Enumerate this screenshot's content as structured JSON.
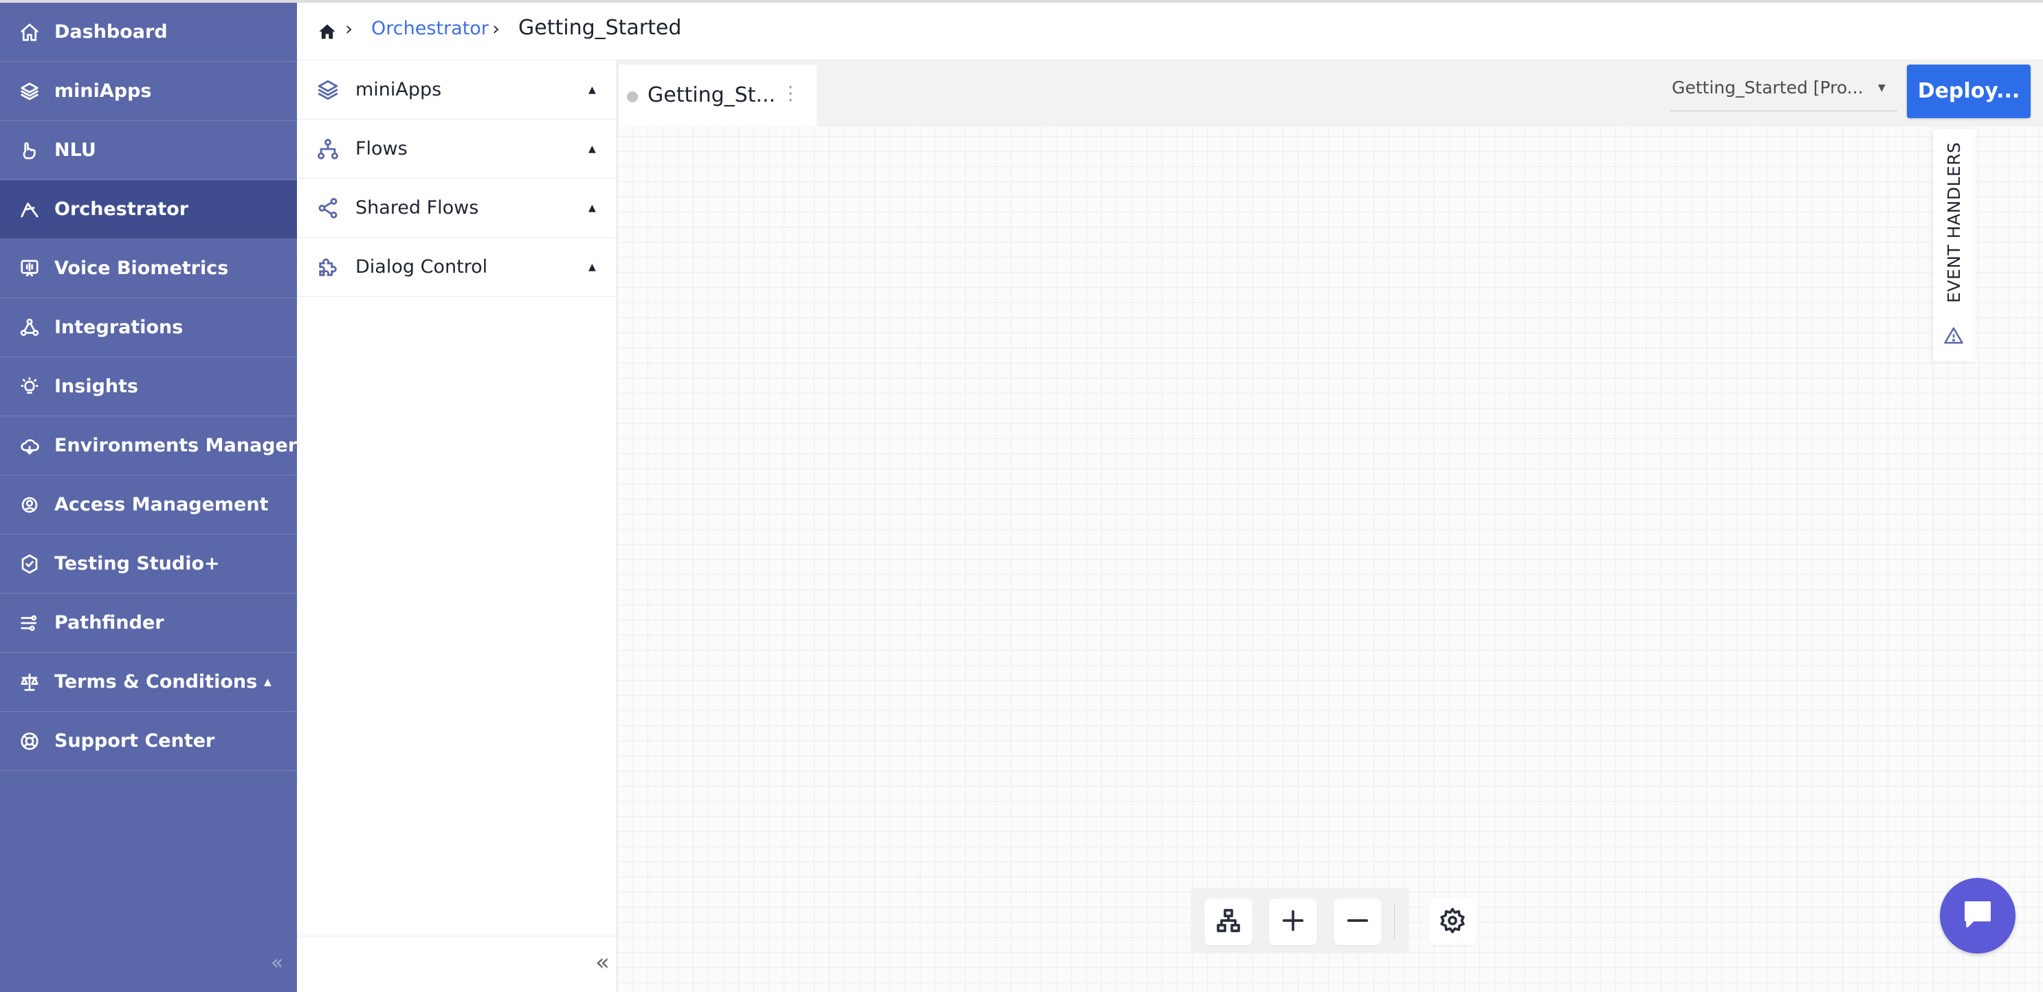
{
  "colors": {
    "sidebar_bg": "#5a67a8",
    "sidebar_active": "#3f4c8e",
    "link": "#3f6fe3",
    "deploy_button": "#2d6ee8",
    "chat_button": "#5c5ad6"
  },
  "sidebar": {
    "items": [
      {
        "label": "Dashboard",
        "icon": "home-icon"
      },
      {
        "label": "miniApps",
        "icon": "layers-icon"
      },
      {
        "label": "NLU",
        "icon": "nlu-icon"
      },
      {
        "label": "Orchestrator",
        "icon": "orchestrator-icon",
        "active": true
      },
      {
        "label": "Voice Biometrics",
        "icon": "voice-biometrics-icon"
      },
      {
        "label": "Integrations",
        "icon": "integrations-icon"
      },
      {
        "label": "Insights",
        "icon": "lightbulb-icon"
      },
      {
        "label": "Environments Manager",
        "icon": "cloud-icon"
      },
      {
        "label": "Access Management",
        "icon": "access-gear-icon"
      },
      {
        "label": "Testing Studio+",
        "icon": "testing-icon"
      },
      {
        "label": "Pathfinder",
        "icon": "pathfinder-icon"
      },
      {
        "label": "Terms & Conditions",
        "icon": "scale-icon",
        "expandable": true
      },
      {
        "label": "Support Center",
        "icon": "lifebuoy-icon"
      }
    ],
    "collapse_glyph": "«"
  },
  "breadcrumb": {
    "home_icon": "home-icon",
    "separator": "›",
    "link": "Orchestrator",
    "current": "Getting_Started"
  },
  "panel": {
    "items": [
      {
        "label": "miniApps",
        "icon": "layers-icon"
      },
      {
        "label": "Flows",
        "icon": "flows-icon"
      },
      {
        "label": "Shared Flows",
        "icon": "share-icon"
      },
      {
        "label": "Dialog Control",
        "icon": "puzzle-icon"
      }
    ],
    "caret": "▲",
    "collapse_glyph": "«"
  },
  "canvas": {
    "tab": {
      "label": "Getting_St...",
      "menu_glyph": "⋮"
    },
    "environment": {
      "value": "Getting_Started [Pro...",
      "arrow": "▼"
    },
    "deploy_label": "Deploy...",
    "event_handlers_label": "EVENT HANDLERS",
    "toolbar": [
      "hierarchy-icon",
      "zoom-in-icon",
      "zoom-out-icon",
      "settings-icon"
    ]
  }
}
